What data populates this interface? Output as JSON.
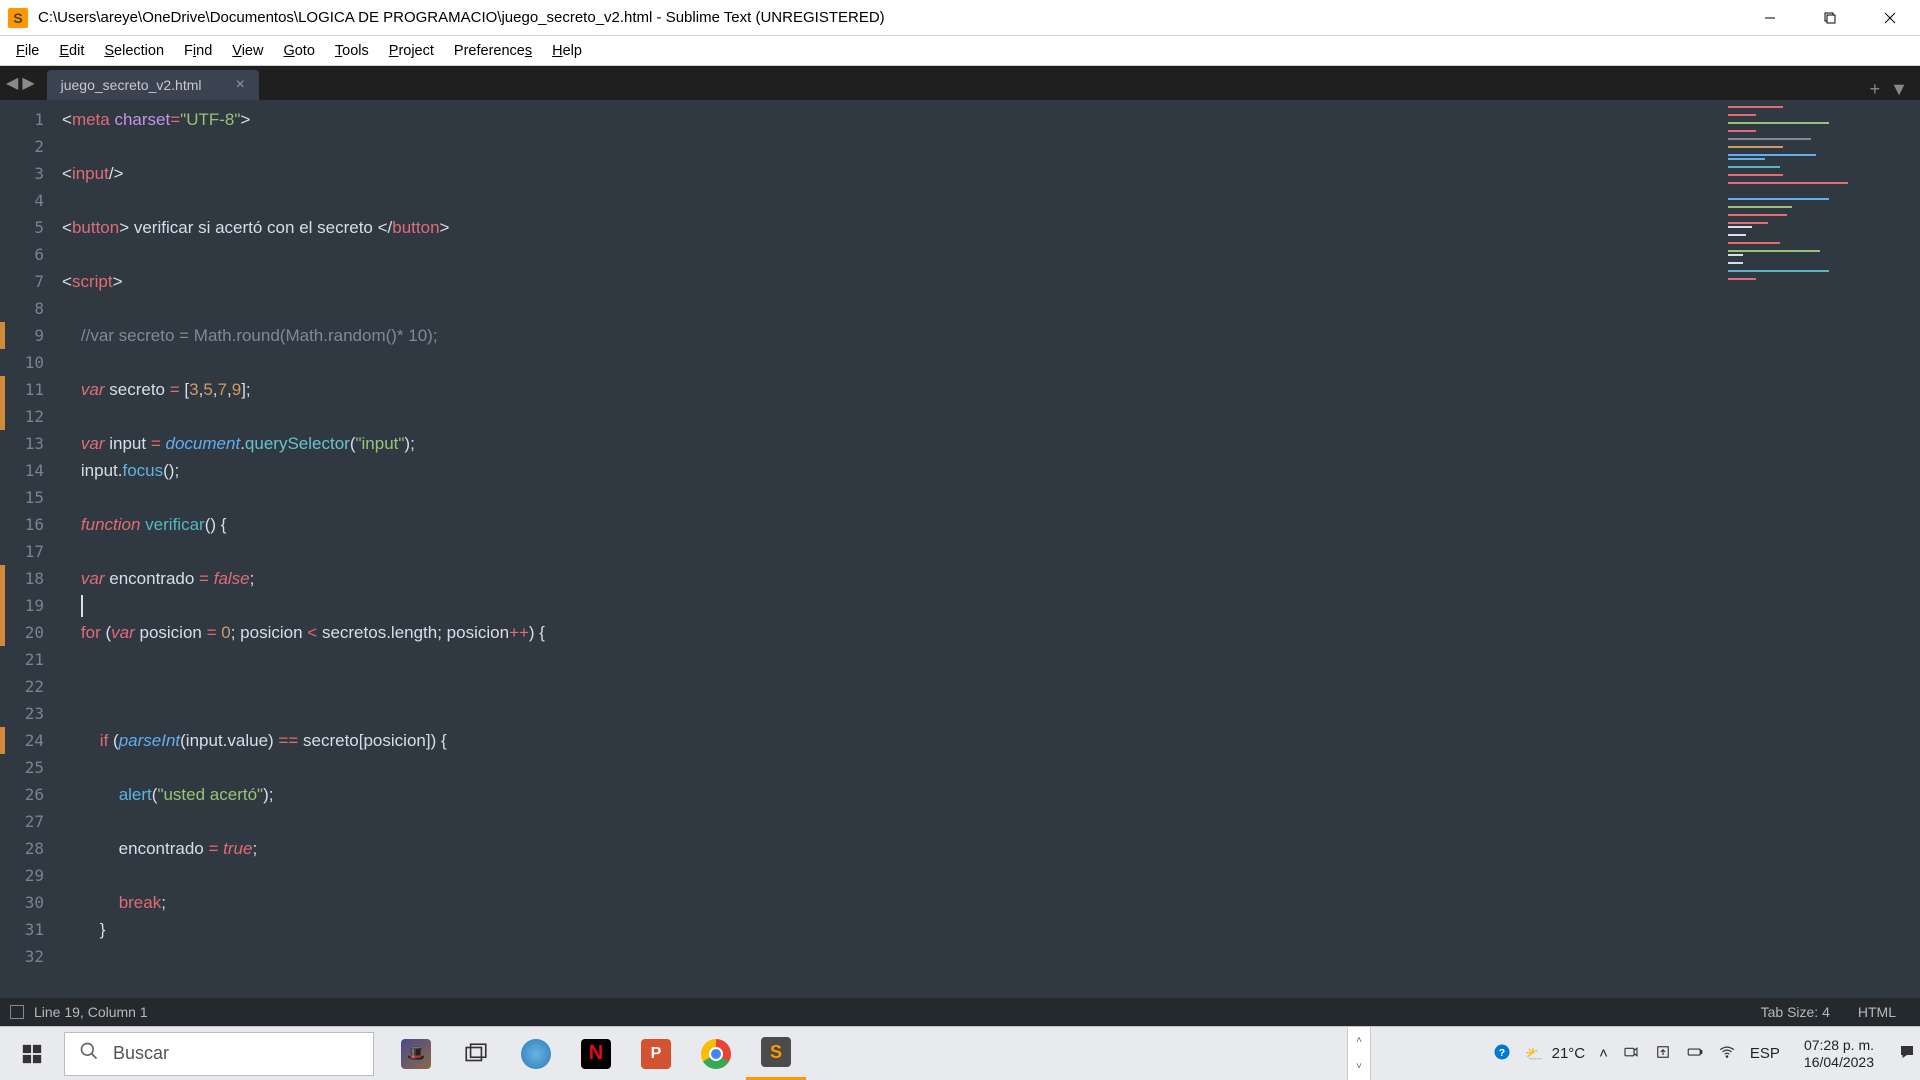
{
  "titlebar": {
    "path": "C:\\Users\\areye\\OneDrive\\Documentos\\LOGICA DE PROGRAMACIO\\juego_secreto_v2.html - Sublime Text (UNREGISTERED)"
  },
  "menubar": [
    "File",
    "Edit",
    "Selection",
    "Find",
    "View",
    "Goto",
    "Tools",
    "Project",
    "Preferences",
    "Help"
  ],
  "tabs": {
    "first": "juego_secreto_v2.html"
  },
  "gutter": {
    "start": 1,
    "end": 32
  },
  "modified_lines": [
    9,
    11,
    12,
    18,
    19,
    20,
    24
  ],
  "code": {
    "l1": {
      "a": "<",
      "b": "meta ",
      "c": "charset",
      "d": "=",
      "e": "\"UTF-8\"",
      "f": ">"
    },
    "l3": {
      "a": "<",
      "b": "input",
      "c": "/>"
    },
    "l5": {
      "a": "<",
      "b": "button",
      "c": "> verificar si acertó con el secreto </",
      "d": "button",
      "e": ">"
    },
    "l7": {
      "a": "<",
      "b": "script",
      "c": ">"
    },
    "l9": "    //var secreto = Math.round(Math.random()* 10);",
    "l11": {
      "a": "    ",
      "b": "var ",
      "c": "secreto ",
      "d": "=",
      "e": " [",
      "f": "3",
      "g": ",",
      "h": "5",
      "i": ",",
      "j": "7",
      "k": ",",
      "l": "9",
      "m": "];"
    },
    "l13": {
      "a": "    ",
      "b": "var ",
      "c": "input ",
      "d": "=",
      "e": " ",
      "f": "document",
      "g": ".",
      "h": "querySelector",
      "i": "(",
      "j": "\"input\"",
      "k": ");"
    },
    "l14": {
      "a": "    input.",
      "b": "focus",
      "c": "();"
    },
    "l16": {
      "a": "    ",
      "b": "function ",
      "c": "verificar",
      "d": "() {"
    },
    "l18": {
      "a": "    ",
      "b": "var ",
      "c": "encontrado ",
      "d": "=",
      "e": " ",
      "f": "false",
      "g": ";"
    },
    "l20": {
      "a": "    ",
      "b": "for ",
      "c": "(",
      "d": "var ",
      "e": "posicion ",
      "f": "=",
      "g": " ",
      "h": "0",
      "i": "; posicion ",
      "j": "<",
      "k": " secretos.length; posicion",
      "l": "++",
      "m": ") {"
    },
    "l24": {
      "a": "        ",
      "b": "if ",
      "c": "(",
      "d": "parseInt",
      "e": "(input.value) ",
      "f": "==",
      "g": " secreto[posicion]) {"
    },
    "l26": {
      "a": "            ",
      "b": "alert",
      "c": "(",
      "d": "\"usted acertó\"",
      "e": ");"
    },
    "l28": {
      "a": "            encontrado ",
      "b": "=",
      "c": " ",
      "d": "true",
      "e": ";"
    },
    "l30": {
      "a": "            ",
      "b": "break",
      "c": ";"
    },
    "l31": "        }"
  },
  "statusbar": {
    "pos": "Line 19, Column 1",
    "tabsize": "Tab Size: 4",
    "syntax": "HTML"
  },
  "taskbar": {
    "search_placeholder": "Buscar",
    "weather": "21°C",
    "lang": "ESP",
    "time": "07:28 p. m.",
    "date": "16/04/2023"
  }
}
